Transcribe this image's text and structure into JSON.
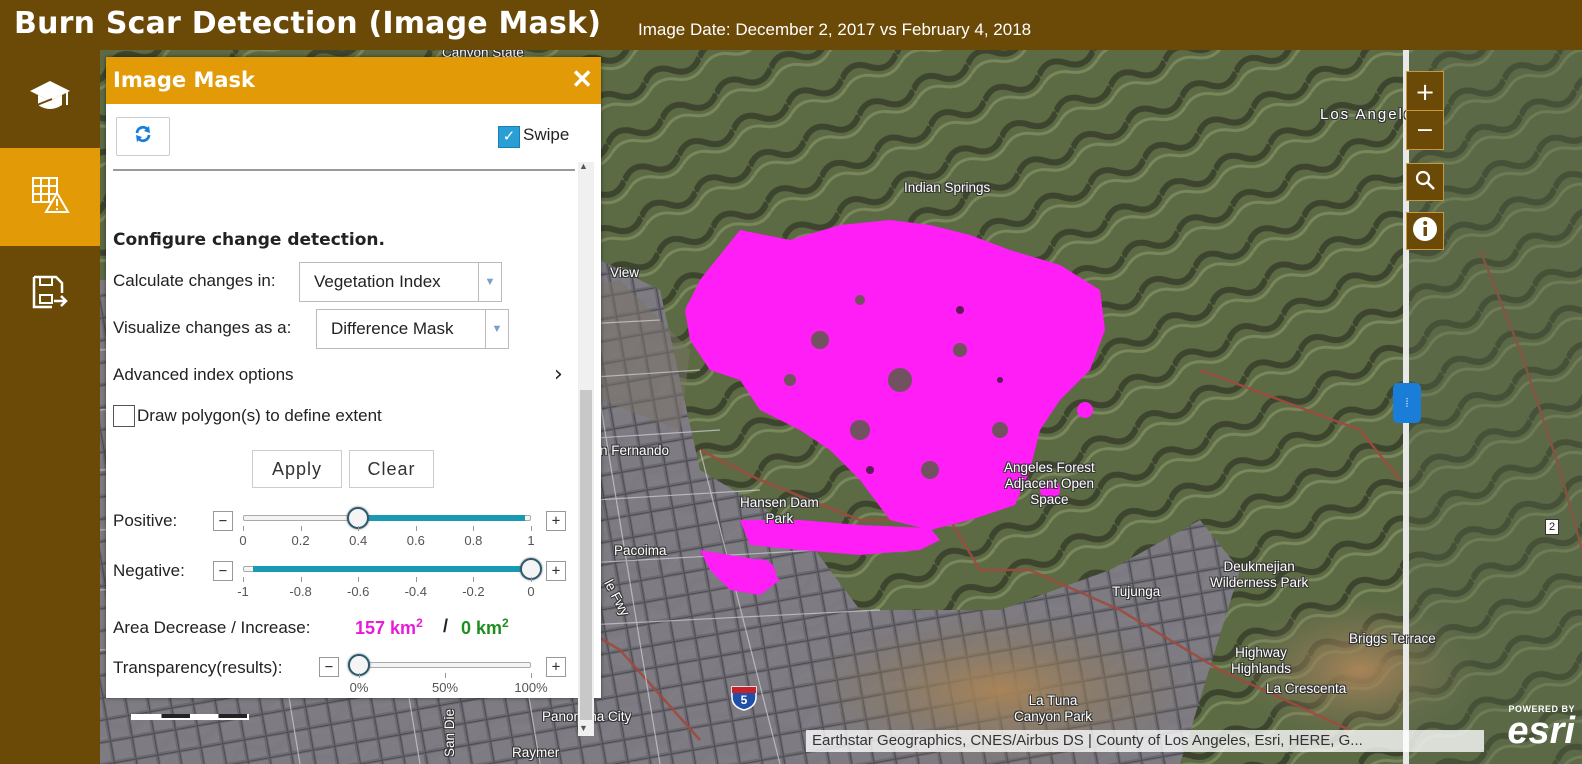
{
  "header": {
    "title": "Burn Scar Detection (Image Mask)",
    "image_date": "Image Date: December 2, 2017 vs February 4, 2018"
  },
  "sidebar": {
    "items": [
      {
        "name": "about",
        "icon": "graduation-cap-icon"
      },
      {
        "name": "image-mask",
        "icon": "grid-warning-icon",
        "active": true
      },
      {
        "name": "export",
        "icon": "save-export-icon"
      }
    ]
  },
  "panel": {
    "title": "Image Mask",
    "close": "✕",
    "refresh_icon": "refresh-icon",
    "swipe_label": "Swipe",
    "swipe_checked": true,
    "heading": "Configure change detection.",
    "calc_label": "Calculate changes in:",
    "calc_value": "Vegetation Index",
    "viz_label": "Visualize changes as a:",
    "viz_value": "Difference Mask",
    "advanced_label": "Advanced index options",
    "advanced_chevron": "›",
    "draw_label": "Draw polygon(s) to define extent",
    "draw_checked": false,
    "apply_label": "Apply",
    "clear_label": "Clear",
    "positive": {
      "label": "Positive:",
      "value": 0.4,
      "min": 0,
      "max": 1,
      "ticks": [
        "0",
        "0.2",
        "0.4",
        "0.6",
        "0.8",
        "1"
      ]
    },
    "negative": {
      "label": "Negative:",
      "value": 0,
      "min": -1,
      "max": 0,
      "ticks": [
        "-1",
        "-0.8",
        "-0.6",
        "-0.4",
        "-0.2",
        "0"
      ]
    },
    "area_label": "Area Decrease / Increase:",
    "area_decrease": "157 km",
    "area_increase": "0 km",
    "area_unit_sup": "2",
    "area_separator": "/",
    "transparency": {
      "label": "Transparency(results):",
      "value_percent": 0,
      "ticks": [
        "0%",
        "50%",
        "100%"
      ]
    },
    "stepper_minus": "−",
    "stepper_plus": "+"
  },
  "map": {
    "labels": {
      "canyon_state": "Canyon State",
      "los_angeles": "Los Angeles",
      "indian_springs": "Indian Springs",
      "view": "View",
      "san_fernando": "n Fernando",
      "angeles_forest": "Angeles Forest\nAdjacent Open\nSpace",
      "hansen_dam": "Hansen Dam\nPark",
      "pacoima": "Pacoima",
      "fwy": "le Fwy",
      "tujunga": "Tujunga",
      "deukmejian": "Deukmejian\nWilderness Park",
      "briggs": "Briggs Terrace",
      "highway_highlands": "Highway\nHighlands",
      "la_crescenta": "La Crescenta",
      "la_tuna": "La Tuna\nCanyon Park",
      "panorama": "Panorama City",
      "san_diego": "San Die",
      "raymer": "Raymer"
    },
    "shield_number": "5",
    "page_marker": "2",
    "attribution": "Earthstar Geographics, CNES/Airbus DS | County of Los Angeles, Esri, HERE, G...",
    "esri_powered": "POWERED BY",
    "esri_word": "esri",
    "zoom_in": "+",
    "zoom_out": "−",
    "search_icon": "search-icon",
    "info_icon": "info-icon",
    "swipe_handle_glyph": "⦙",
    "burn_mask_color": "#ff1ef5"
  }
}
